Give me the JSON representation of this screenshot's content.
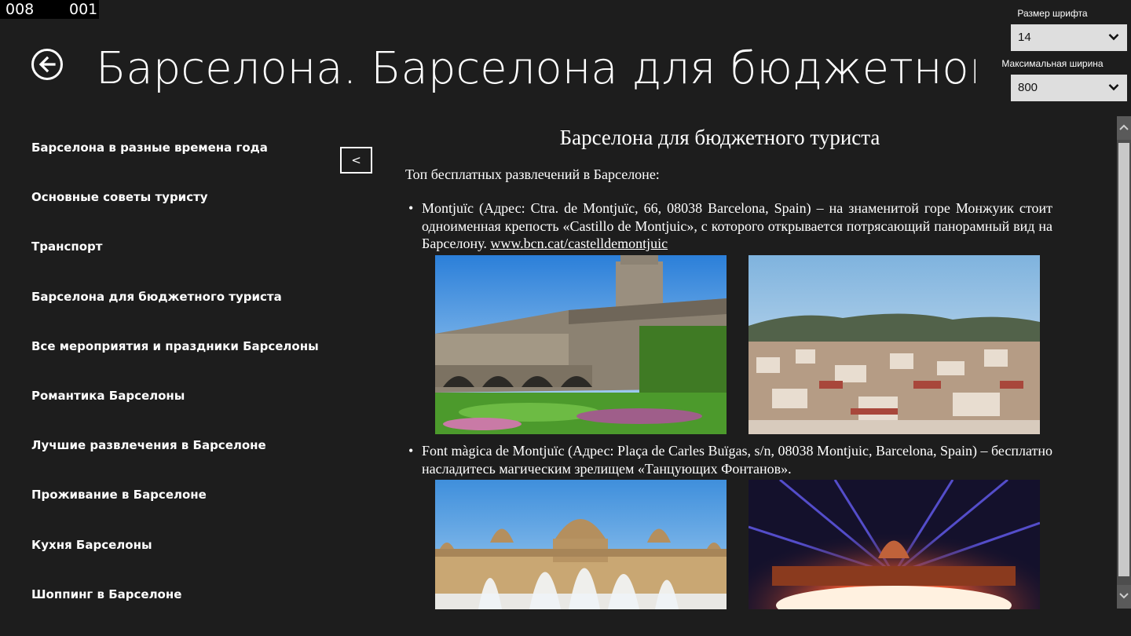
{
  "counter": {
    "left": "008",
    "right": "001"
  },
  "header": {
    "title": "Барселона.   Барселона для бюджетного т..."
  },
  "settings": {
    "font_size_label": "Размер шрифта",
    "font_size_value": "14",
    "max_width_label": "Максимальная ширина",
    "max_width_value": "800"
  },
  "sidebar": {
    "collapse_label": "<",
    "items": [
      {
        "label": "Барселона в разные времена года"
      },
      {
        "label": "Основные советы туристу"
      },
      {
        "label": "Транспорт"
      },
      {
        "label": "Барселона для бюджетного туриста"
      },
      {
        "label": "Все мероприятия и праздники Барселоны"
      },
      {
        "label": "Романтика Барселоны"
      },
      {
        "label": "Лучшие развлечения в Барселоне"
      },
      {
        "label": "Проживание в Барселоне"
      },
      {
        "label": "Кухня Барселоны"
      },
      {
        "label": "Шоппинг в Барселоне"
      }
    ]
  },
  "article": {
    "title": "Барселона для бюджетного туриста",
    "intro": "Топ бесплатных развлечений в Барселоне:",
    "bullets": [
      {
        "text": "Montjuïc (Адрес: Ctra. de Montjuïc, 66, 08038 Barcelona, Spain) – на знаменитой горе Монжуик стоит одноименная крепость «Castillo de Montjuic», с которого открывается потрясающий панорамный вид на Барселону. ",
        "link": "www.bcn.cat/castelldemontjuic"
      },
      {
        "text": "Font màgica de Montjuïc (Адрес: Plaça de Carles Buïgas, s/n, 08038 Montjuic, Barcelona, Spain) – бесплатно насладитесь магическим зрелищем «Танцующих Фонтанов».",
        "link": ""
      }
    ]
  },
  "icons": {
    "back": "back-arrow-icon",
    "chevron": "chevron-down-icon",
    "scroll_up": "scroll-up-icon",
    "scroll_down": "scroll-down-icon"
  },
  "colors": {
    "background": "#1d1d1d",
    "select_bg": "#dedede",
    "scrollbar": "#4d4d4d"
  }
}
